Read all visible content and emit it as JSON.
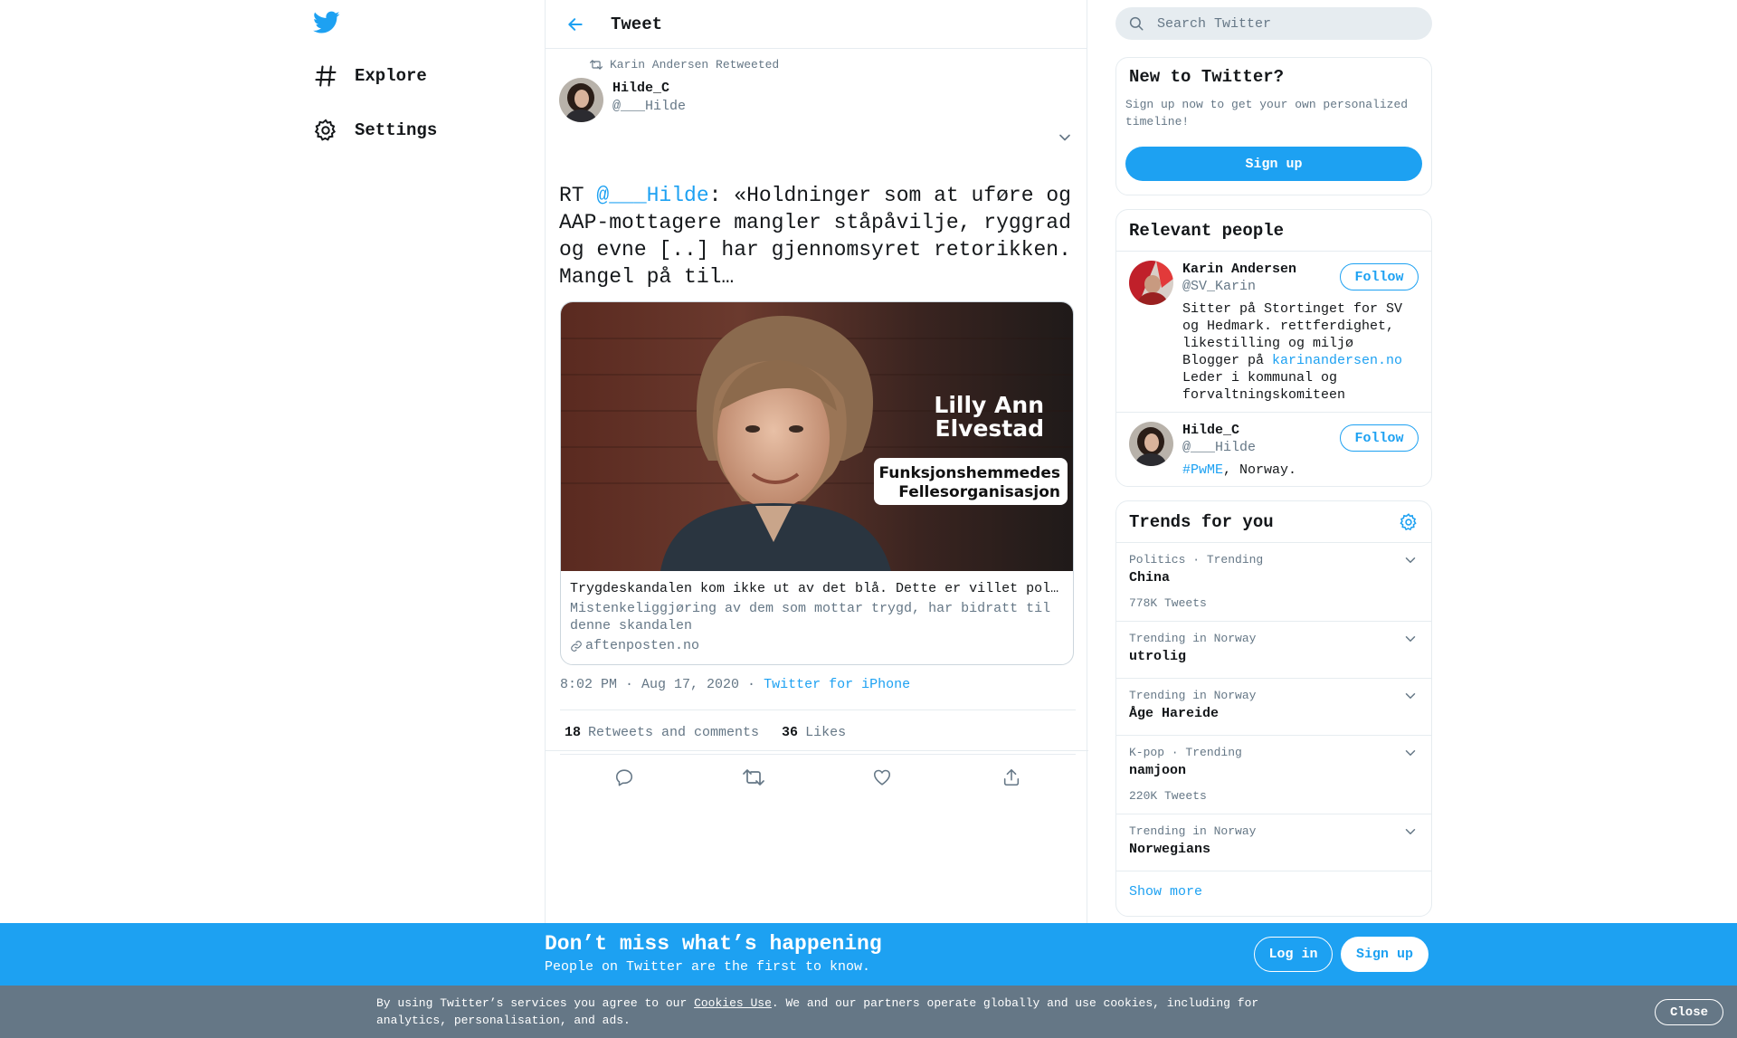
{
  "nav": {
    "logo": "twitter-bird-icon",
    "explore": "Explore",
    "settings": "Settings"
  },
  "header": {
    "title": "Tweet"
  },
  "tweet": {
    "retweet_context": "Karin Andersen Retweeted",
    "author_name": "Hilde_C",
    "author_handle": "@___Hilde",
    "text_prefix": "RT ",
    "text_mention": "@___Hilde",
    "text_body": ": «Holdninger som at uføre og AAP-mottagere mangler ståpåvilje, ryggrad og evne [..] har gjennomsyret retorikken. Mangel på til…",
    "card": {
      "image_name": "Lilly Ann Elvestad",
      "image_line1": "Lilly Ann",
      "image_line2": "Elvestad",
      "image_org1": "Funksjonshemmedes",
      "image_org2": "Fellesorganisasjon",
      "title": "Trygdeskandalen kom ikke ut av det blå. Dette er villet pol…",
      "description": "Mistenkeliggjøring av dem som mottar trygd, har bidratt til denne skandalen",
      "domain": "aftenposten.no"
    },
    "time": "8:02 PM · Aug 17, 2020",
    "separator": " · ",
    "source": "Twitter for iPhone",
    "retweets_count": "18",
    "retweets_label": "Retweets and comments",
    "likes_count": "36",
    "likes_label": "Likes"
  },
  "search": {
    "placeholder": "Search Twitter"
  },
  "new_to_twitter": {
    "title": "New to Twitter?",
    "body": "Sign up now to get your own personalized timeline!",
    "button": "Sign up"
  },
  "relevant_people": {
    "title": "Relevant people",
    "follow_label": "Follow",
    "people": [
      {
        "name": "Karin Andersen",
        "handle": "@SV_Karin",
        "bio_before": "Sitter på Stortinget for SV og Hedmark. rettferdighet, likestilling og miljø Blogger på ",
        "bio_link": "karinandersen.no",
        "bio_after": " Leder i kommunal og forvaltningskomiteen"
      },
      {
        "name": "Hilde_C",
        "handle": "@___Hilde",
        "bio_link": "#PwME",
        "bio_after": ", Norway."
      }
    ]
  },
  "trends": {
    "title": "Trends for you",
    "items": [
      {
        "meta": "Politics · Trending",
        "name": "China",
        "count": "778K Tweets"
      },
      {
        "meta": "Trending in Norway",
        "name": "utrolig",
        "count": ""
      },
      {
        "meta": "Trending in Norway",
        "name": "Åge Hareide",
        "count": ""
      },
      {
        "meta": "K-pop · Trending",
        "name": "namjoon",
        "count": "220K Tweets"
      },
      {
        "meta": "Trending in Norway",
        "name": "Norwegians",
        "count": ""
      }
    ],
    "show_more": "Show more"
  },
  "banner": {
    "headline": "Don’t miss what’s happening",
    "sub": "People on Twitter are the first to know.",
    "login": "Log in",
    "signup": "Sign up"
  },
  "cookie": {
    "text_before": "By using Twitter’s services you agree to our ",
    "link": "Cookies Use",
    "text_after": ". We and our partners operate globally and use cookies, including for analytics, personalisation, and ads.",
    "close": "Close"
  },
  "colors": {
    "accent": "#1da1f2",
    "text": "#14171a",
    "muted": "#657786",
    "border": "#e6ecf0",
    "cookie_bg": "#657786"
  }
}
